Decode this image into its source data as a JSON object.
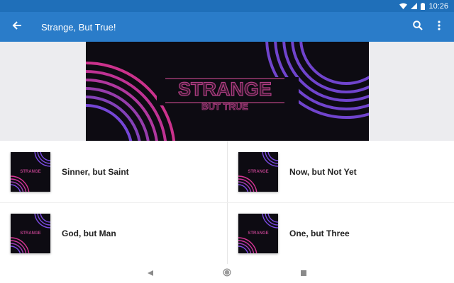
{
  "status_bar": {
    "time": "10:26"
  },
  "app_bar": {
    "title": "Strange, But True!"
  },
  "banner": {
    "line1": "STRANGE",
    "line2": "BUT TRUE"
  },
  "items": [
    {
      "title": "Sinner, but Saint"
    },
    {
      "title": "Now, but Not Yet"
    },
    {
      "title": "God, but Man"
    },
    {
      "title": "One, but Three"
    }
  ],
  "colors": {
    "app_bar": "#2a7cc9",
    "status_bar": "#1f6fb9",
    "neon_pink": "#e0379b",
    "neon_purple": "#7b4ae2"
  }
}
